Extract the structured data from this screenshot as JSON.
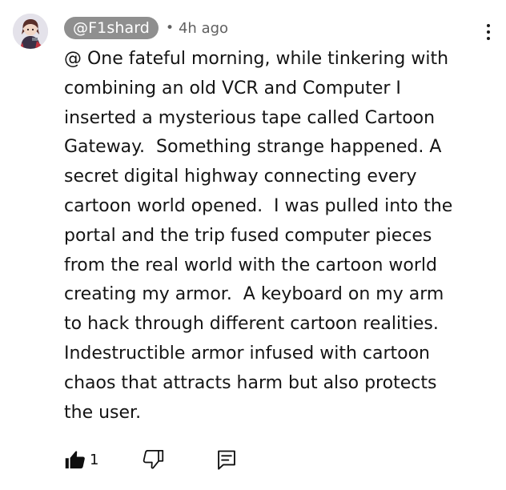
{
  "comment": {
    "author_handle": "@F1shard",
    "separator": "•",
    "timestamp": "4h ago",
    "text": "@ One fateful morning, while tinkering with\ncombining an old VCR and Computer I\ninserted a mysterious tape called Cartoon\nGateway.  Something strange happened. A\nsecret digital highway connecting every\ncartoon world opened.  I was pulled into the\nportal and the trip fused computer pieces\nfrom the real world with the cartoon world\ncreating my armor.  A keyboard on my arm\nto hack through different cartoon realities.\nIndestructible armor infused with cartoon\nchaos that attracts harm but also protects\nthe user.",
    "like_count": "1"
  },
  "icons": {
    "avatar": "avatar-image",
    "more": "more-vertical-icon",
    "like": "thumbs-up-filled-icon",
    "dislike": "thumbs-down-outline-icon",
    "reply": "reply-comment-icon"
  },
  "colors": {
    "handle_chip_bg": "#8f8f8f",
    "text": "#141414",
    "muted": "#606060"
  }
}
